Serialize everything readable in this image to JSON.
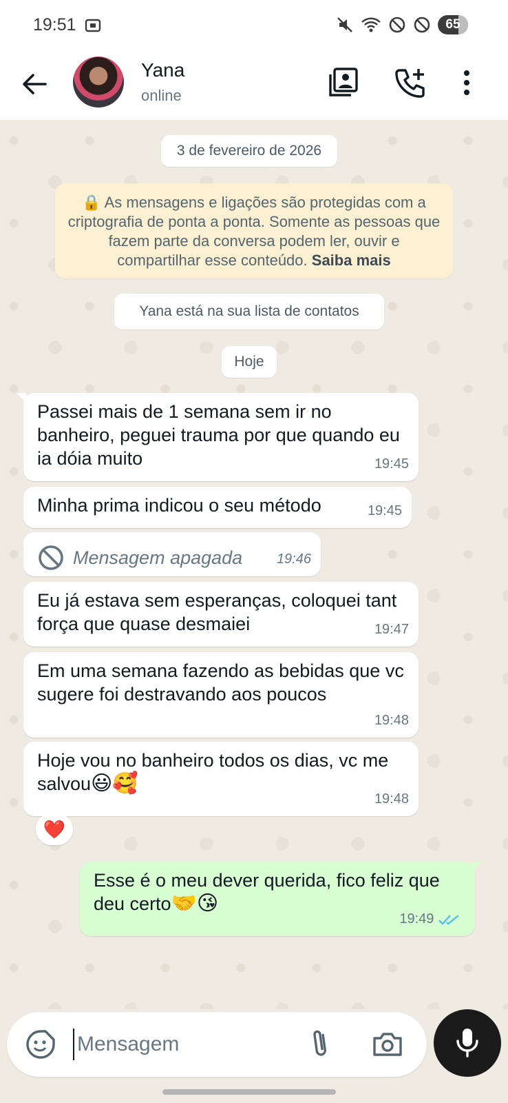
{
  "status_bar": {
    "time": "19:51",
    "battery": "65"
  },
  "header": {
    "contact_name": "Yana",
    "contact_status": "online"
  },
  "chat": {
    "date_pill": "3 de fevereiro de 2026",
    "encryption_notice": "As mensagens e ligações são protegidas com a criptografia de ponta a ponta. Somente as pessoas que fazem parte da conversa podem ler, ouvir e compartilhar esse conteúdo.",
    "encryption_link": "Saiba mais",
    "contact_info": "Yana está na sua lista de contatos",
    "today_pill": "Hoje",
    "messages": [
      {
        "text": "Passei mais de 1 semana sem ir no banheiro, peguei trauma por que quando eu ia dóia muito",
        "time": "19:45"
      },
      {
        "text": "Minha prima indicou o seu método",
        "time": "19:45"
      },
      {
        "text": "Mensagem apagada",
        "time": "19:46"
      },
      {
        "text": "Eu já estava sem esperanças, coloquei tant força que quase desmaiei",
        "time": "19:47"
      },
      {
        "text": "Em uma semana fazendo as bebidas que vc sugere foi destravando aos poucos",
        "time": "19:48"
      },
      {
        "text": "Hoje vou no banheiro todos os dias, vc me salvou",
        "emoji": "😃🥰",
        "time": "19:48"
      }
    ],
    "reaction": "❤️",
    "outgoing": {
      "text": "Esse é o meu dever querida, fico feliz que deu certo",
      "emoji": "🤝😘",
      "time": "19:49"
    }
  },
  "composer": {
    "placeholder": "Mensagem"
  },
  "colors": {
    "outgoing_bubble": "#d9fdd3",
    "notice_bg": "#fcf0d2",
    "read_ticks": "#53bdeb"
  }
}
